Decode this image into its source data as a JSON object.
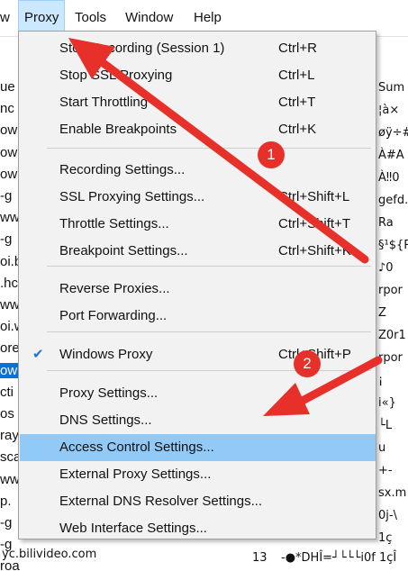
{
  "menubar": {
    "items": [
      {
        "label": "w"
      },
      {
        "label": "Proxy"
      },
      {
        "label": "Tools"
      },
      {
        "label": "Window"
      },
      {
        "label": "Help"
      }
    ]
  },
  "proxy_menu": {
    "items": [
      {
        "label": "Stop Recording (Session 1)",
        "shortcut": "Ctrl+R"
      },
      {
        "label": "Stop SSL Proxying",
        "shortcut": "Ctrl+L"
      },
      {
        "label": "Start Throttling",
        "shortcut": "Ctrl+T"
      },
      {
        "label": "Enable Breakpoints",
        "shortcut": "Ctrl+K"
      },
      {
        "label": "Recording Settings...",
        "shortcut": ""
      },
      {
        "label": "SSL Proxying Settings...",
        "shortcut": "Ctrl+Shift+L"
      },
      {
        "label": "Throttle Settings...",
        "shortcut": "Ctrl+Shift+T"
      },
      {
        "label": "Breakpoint Settings...",
        "shortcut": "Ctrl+Shift+K"
      },
      {
        "label": "Reverse Proxies...",
        "shortcut": ""
      },
      {
        "label": "Port Forwarding...",
        "shortcut": ""
      },
      {
        "label": "Windows Proxy",
        "shortcut": "Ctrl+Shift+P",
        "checked": true
      },
      {
        "label": "Proxy Settings...",
        "shortcut": ""
      },
      {
        "label": "DNS Settings...",
        "shortcut": ""
      },
      {
        "label": "Access Control Settings...",
        "shortcut": "",
        "highlighted": true
      },
      {
        "label": "External Proxy Settings...",
        "shortcut": ""
      },
      {
        "label": "External DNS Resolver Settings...",
        "shortcut": ""
      },
      {
        "label": "Web Interface Settings...",
        "shortcut": ""
      }
    ],
    "check_glyph": "✔"
  },
  "background": {
    "left_items": [
      "ue",
      "nc",
      "ow",
      "ow",
      "ow",
      "-g",
      "ww",
      "-g",
      "oi.b",
      ".hc",
      "ww",
      "oi.w",
      "ore",
      "ow",
      "cti",
      "os",
      "ray",
      "sca",
      "ww",
      "p.",
      "-g",
      "-g",
      "roa"
    ],
    "left_selected_index": 13,
    "bottom_host": "yc.bilivideo.com",
    "bottom_line_number": "13",
    "right_items": [
      "Sum",
      "¦à×",
      "øÿ÷#",
      "À#A",
      "À‼0",
      "gefd.",
      "Ra",
      "§¹${R",
      "♪0",
      "rpor",
      "Z",
      "Z0r1",
      "rpor",
      "¡",
      "i«}",
      "└L",
      "u",
      "+-",
      "sx.m",
      "0j-\\",
      "1ç"
    ],
    "bottom_strip": [
      "+ -",
      "sx.m",
      "-●*DHÎ=┘└└└i0f 1çÎ",
      "╘* ┘ϙ ╟┌ Y└└0j-\\"
    ],
    "tab_label": "Ra"
  },
  "annotations": {
    "badge_1": "1",
    "badge_2": "2",
    "color": "#e8302b"
  }
}
